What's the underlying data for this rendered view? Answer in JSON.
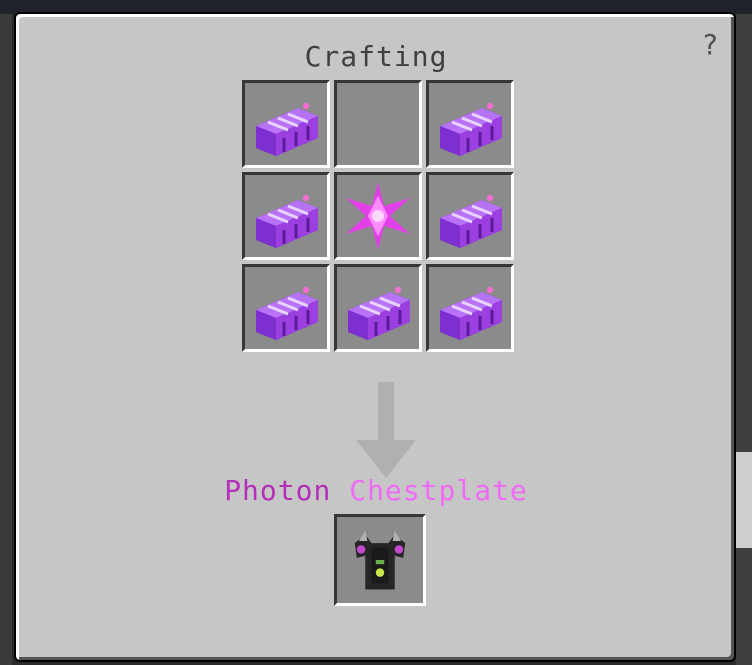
{
  "window": {
    "title": "Crafting",
    "help_label": "?"
  },
  "recipe": {
    "grid": [
      {
        "item": "photon-ingot-icon"
      },
      {
        "item": "empty"
      },
      {
        "item": "photon-ingot-icon"
      },
      {
        "item": "photon-ingot-icon"
      },
      {
        "item": "photon-star-icon"
      },
      {
        "item": "photon-ingot-icon"
      },
      {
        "item": "photon-ingot-icon"
      },
      {
        "item": "photon-ingot-icon"
      },
      {
        "item": "photon-ingot-icon"
      }
    ],
    "arrow": "down-arrow-icon",
    "result": {
      "name_part1": "Photon",
      "name_part2": "Chestplate",
      "icon": "photon-chestplate-icon"
    }
  },
  "colors": {
    "panel": "#c6c6c6",
    "slot": "#8b8b8b",
    "title_text": "#3f3f3f",
    "name_dark_magenta": "#b32fb8",
    "name_light_magenta": "#f16af6",
    "ingot_purple": "#9b3fe0"
  }
}
